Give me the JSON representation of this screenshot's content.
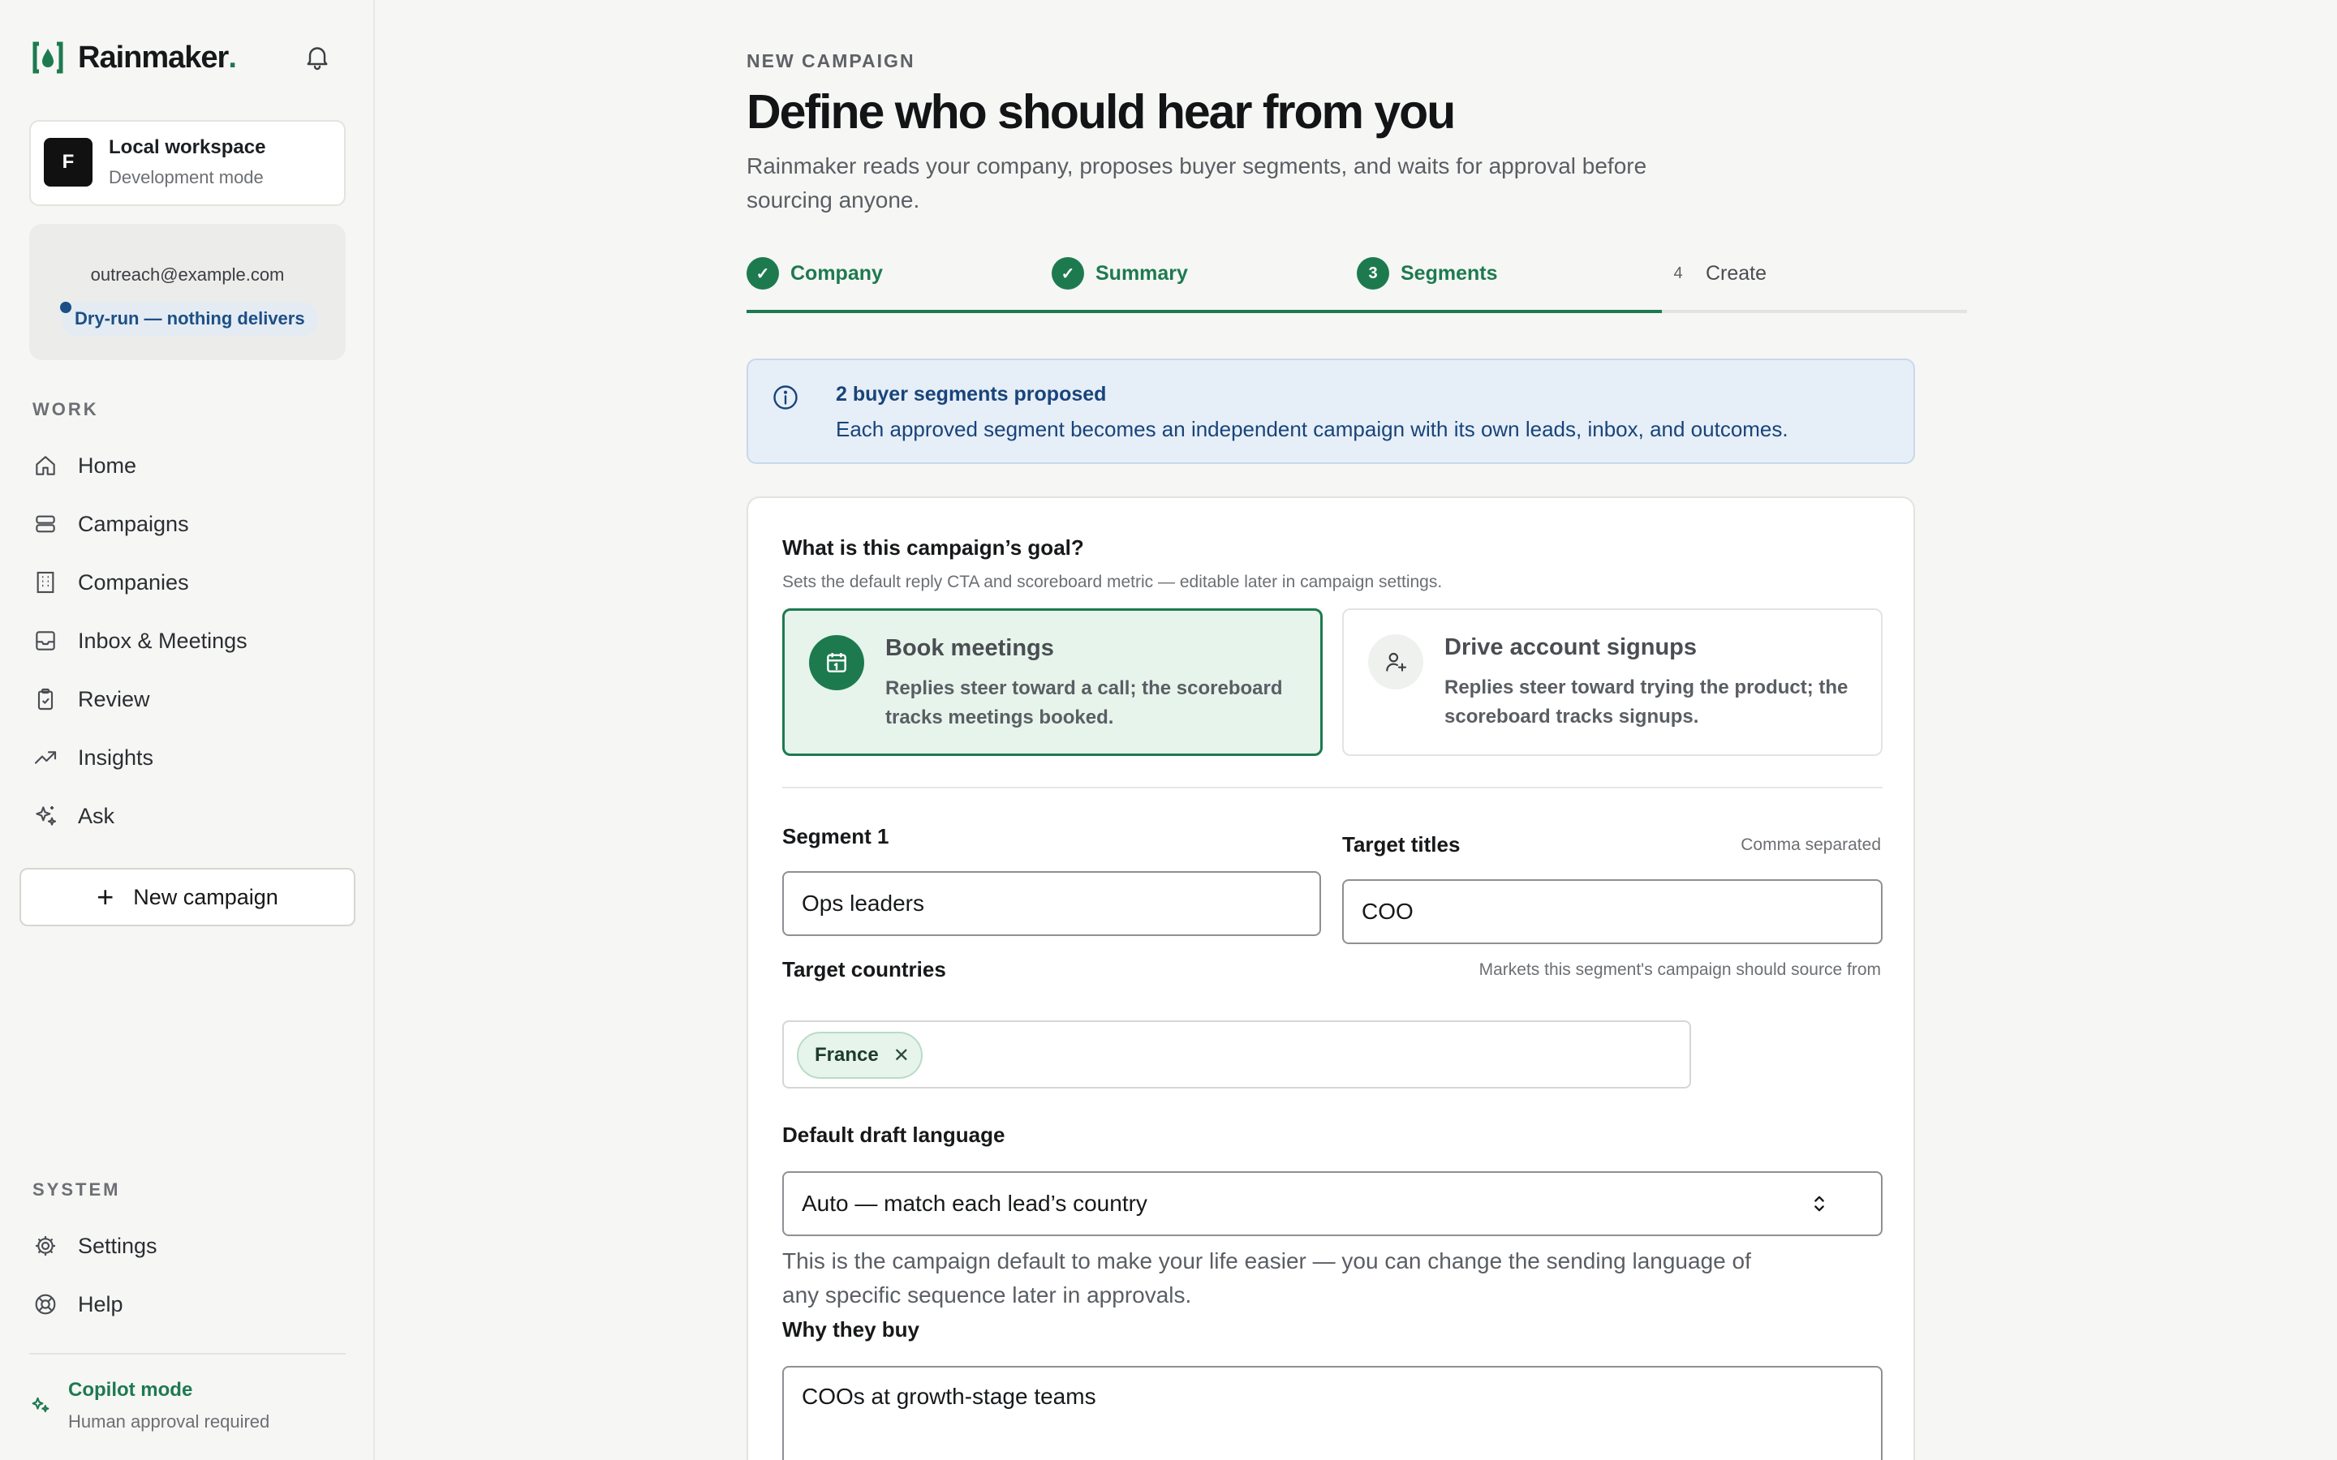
{
  "brand": {
    "name": "Rainmaker",
    "dot": "."
  },
  "workspace": {
    "initial": "F",
    "name": "Local workspace",
    "mode": "Development mode"
  },
  "account": {
    "email": "outreach@example.com",
    "badge": "Dry-run — nothing delivers"
  },
  "sidebar": {
    "work_label": "WORK",
    "items": [
      {
        "label": "Home",
        "icon": "home-icon"
      },
      {
        "label": "Campaigns",
        "icon": "campaigns-icon"
      },
      {
        "label": "Companies",
        "icon": "building-icon"
      },
      {
        "label": "Inbox & Meetings",
        "icon": "inbox-icon"
      },
      {
        "label": "Review",
        "icon": "clipboard-check-icon"
      },
      {
        "label": "Insights",
        "icon": "trend-icon"
      },
      {
        "label": "Ask",
        "icon": "sparkle-icon"
      }
    ],
    "new_campaign_label": "New campaign",
    "system_label": "SYSTEM",
    "system_items": [
      {
        "label": "Settings",
        "icon": "gear-icon"
      },
      {
        "label": "Help",
        "icon": "lifebuoy-icon"
      }
    ],
    "copilot": {
      "title": "Copilot mode",
      "subtitle": "Human approval required"
    }
  },
  "header": {
    "eyebrow": "NEW CAMPAIGN",
    "title": "Define who should hear from you",
    "subtitle": "Rainmaker reads your company, proposes buyer segments, and waits for approval before sourcing anyone."
  },
  "steps": [
    {
      "label": "Company",
      "state": "done",
      "marker": "✓"
    },
    {
      "label": "Summary",
      "state": "done",
      "marker": "✓"
    },
    {
      "label": "Segments",
      "state": "active",
      "marker": "3"
    },
    {
      "label": "Create",
      "state": "todo",
      "marker": "4"
    }
  ],
  "info": {
    "title": "2 buyer segments proposed",
    "body": "Each approved segment becomes an independent campaign with its own leads, inbox, and outcomes."
  },
  "goal": {
    "question": "What is this campaign’s goal?",
    "hint": "Sets the default reply CTA and scoreboard metric — editable later in campaign settings.",
    "options": [
      {
        "title": "Book meetings",
        "desc": "Replies steer toward a call; the scoreboard tracks meetings booked.",
        "selected": true
      },
      {
        "title": "Drive account signups",
        "desc": "Replies steer toward trying the product; the scoreboard tracks signups.",
        "selected": false
      }
    ]
  },
  "segment": {
    "label": "Segment 1",
    "name_value": "Ops leaders",
    "titles_label": "Target titles",
    "titles_hint": "Comma separated",
    "titles_value": "COO",
    "countries_label": "Target countries",
    "countries_hint": "Markets this segment's campaign should source from",
    "countries": [
      "France"
    ],
    "language_label": "Default draft language",
    "language_value": "Auto — match each lead’s country",
    "language_help": "This is the campaign default to make your life easier — you can change the sending language of any specific sequence later in approvals.",
    "why_label": "Why they buy",
    "why_value": "COOs at growth-stage teams"
  },
  "colors": {
    "accent": "#1d7a4f",
    "info_bg": "#e6eef7",
    "info_text": "#18447a"
  }
}
